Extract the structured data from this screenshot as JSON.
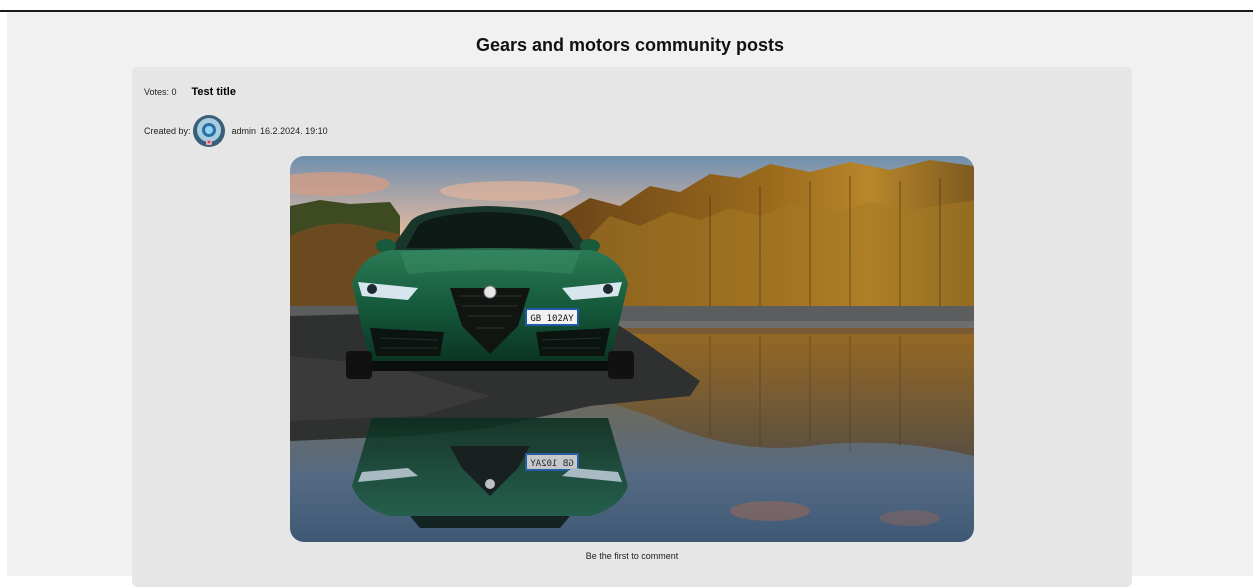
{
  "page": {
    "title": "Gears and motors community posts"
  },
  "post": {
    "votes_label": "Votes: 0",
    "title": "Test title",
    "created_by_label": "Created by:",
    "author": "admin",
    "timestamp": "16.2.2024. 19:10",
    "image_plate": "GB 102AY",
    "image_plate_reflection": "GB 102AY",
    "comment_hint": "Be the first to comment"
  },
  "colors": {
    "page_background": "#f1f1f1",
    "card_background": "#e6e6e6",
    "car_green": "#14573a"
  }
}
